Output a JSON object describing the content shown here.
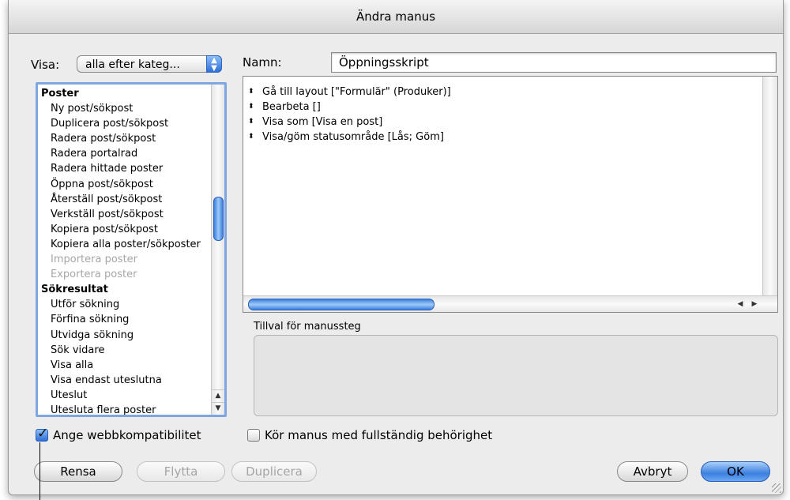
{
  "window": {
    "title": "Ändra manus"
  },
  "view": {
    "label": "Visa:",
    "selected": "alla efter kateg..."
  },
  "name": {
    "label": "Namn:",
    "value": "Öppningsskript"
  },
  "steps": [
    {
      "label": "Poster",
      "type": "category"
    },
    {
      "label": "Ny post/sökpost",
      "type": "item"
    },
    {
      "label": "Duplicera post/sökpost",
      "type": "item"
    },
    {
      "label": "Radera post/sökpost",
      "type": "item"
    },
    {
      "label": "Radera portalrad",
      "type": "item"
    },
    {
      "label": "Radera hittade poster",
      "type": "item"
    },
    {
      "label": "Öppna post/sökpost",
      "type": "item"
    },
    {
      "label": "Återställ post/sökpost",
      "type": "item"
    },
    {
      "label": "Verkställ post/sökpost",
      "type": "item"
    },
    {
      "label": "Kopiera post/sökpost",
      "type": "item"
    },
    {
      "label": "Kopiera alla poster/sökposter",
      "type": "item"
    },
    {
      "label": "Importera poster",
      "type": "disabled"
    },
    {
      "label": "Exportera poster",
      "type": "disabled"
    },
    {
      "label": "Sökresultat",
      "type": "category"
    },
    {
      "label": "Utför sökning",
      "type": "item"
    },
    {
      "label": "Förfina sökning",
      "type": "item"
    },
    {
      "label": "Utvidga sökning",
      "type": "item"
    },
    {
      "label": "Sök vidare",
      "type": "item"
    },
    {
      "label": "Visa alla",
      "type": "item"
    },
    {
      "label": "Visa endast uteslutna",
      "type": "item"
    },
    {
      "label": "Uteslut",
      "type": "item"
    },
    {
      "label": "Utesluta flera poster",
      "type": "item"
    }
  ],
  "script_lines": [
    "Gå till layout [\"Formulär\" (Produker)]",
    "Bearbeta []",
    "Visa som [Visa en post]",
    "Visa/göm statusområde [Lås; Göm]"
  ],
  "options": {
    "label": "Tillval för manussteg"
  },
  "checkboxes": {
    "web": {
      "label": "Ange webbkompatibilitet",
      "checked": true
    },
    "full": {
      "label": "Kör manus med fullständig behörighet",
      "checked": false
    }
  },
  "buttons": {
    "clear": "Rensa",
    "move": "Flytta",
    "duplicate": "Duplicera",
    "cancel": "Avbryt",
    "ok": "OK"
  },
  "colors": {
    "accent": "#3b7fe0",
    "focus_ring": "#7ea6e0"
  }
}
